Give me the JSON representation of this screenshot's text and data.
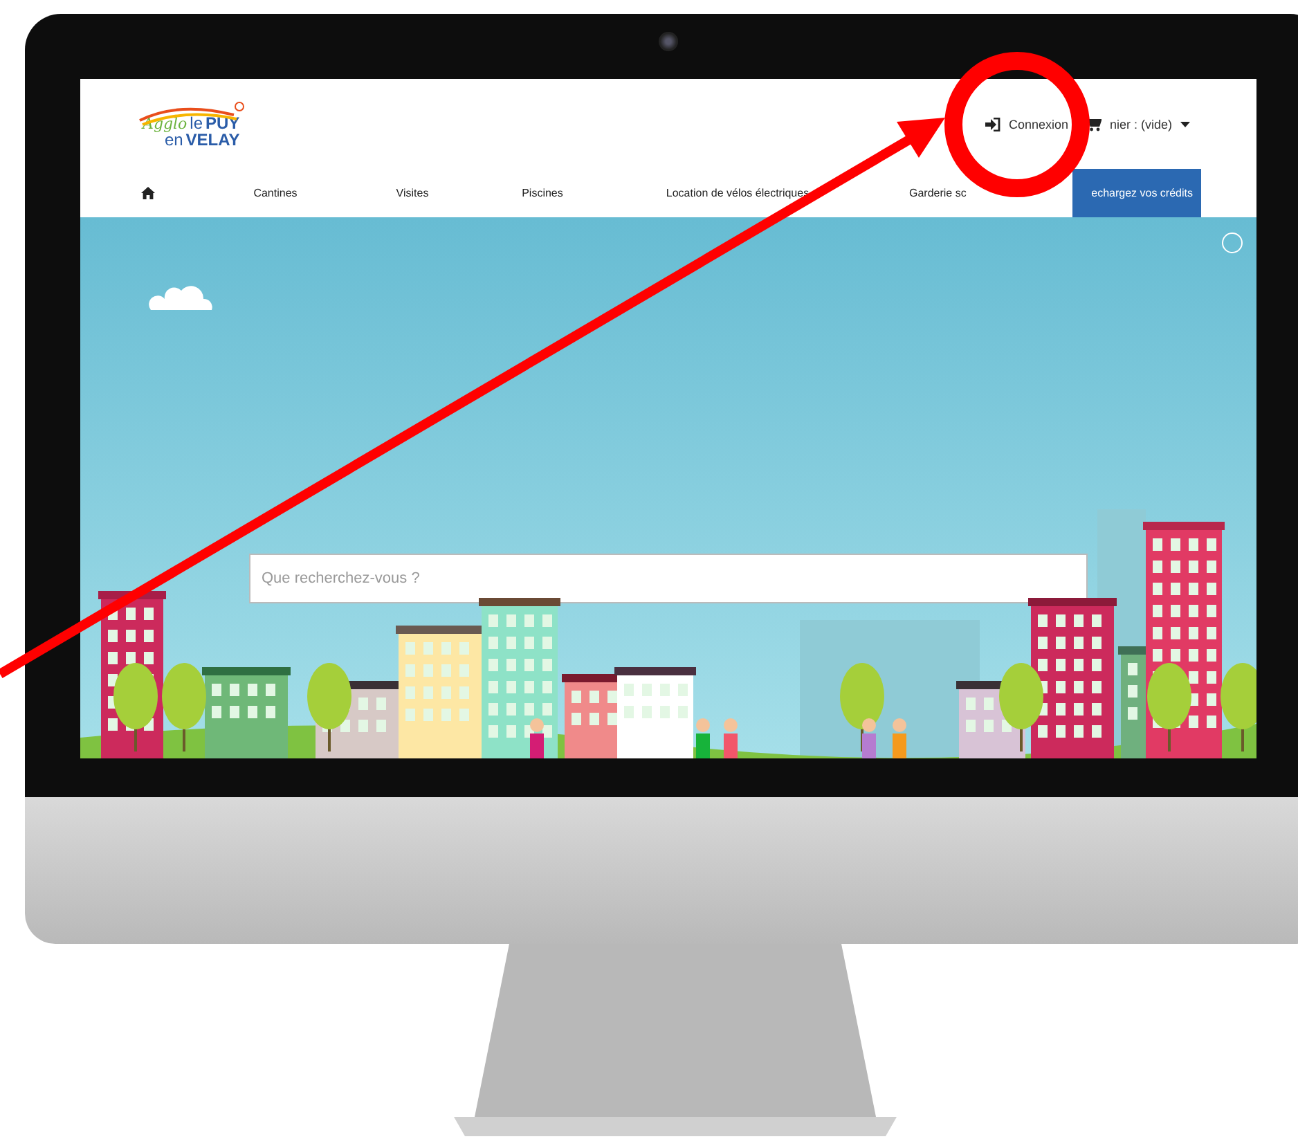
{
  "header": {
    "logo": {
      "word1": "Agglo",
      "word2": "le PUY",
      "word3": "en",
      "word4": "VELAY"
    },
    "links": [
      {
        "kind": "login",
        "label": "Connexion"
      },
      {
        "kind": "cart",
        "label": "nier : (vide)"
      }
    ],
    "nav": [
      {
        "kind": "home"
      },
      {
        "kind": "link",
        "label": "Cantines"
      },
      {
        "kind": "link",
        "label": "Visites"
      },
      {
        "kind": "link",
        "label": "Piscines"
      },
      {
        "kind": "link",
        "label": "Location de vélos électriques"
      },
      {
        "kind": "link",
        "label": "Garderie sc"
      },
      {
        "kind": "button",
        "label": "echargez vos crédits"
      }
    ]
  },
  "hero": {
    "search": {
      "placeholder": "Que recherchez-vous ?"
    }
  }
}
